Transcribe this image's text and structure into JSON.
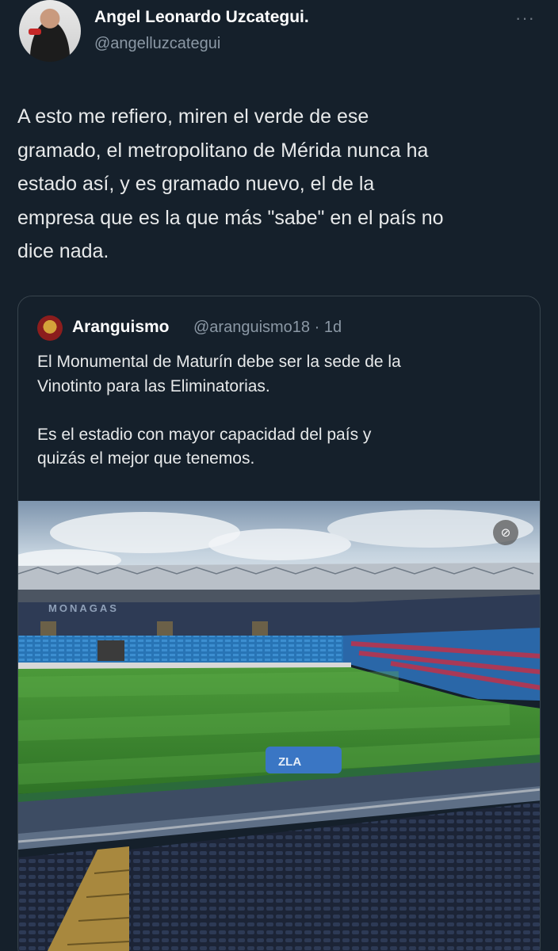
{
  "author": {
    "display_name": "Angel Leonardo Uzcategui.",
    "handle": "@angelluzcategui",
    "avatar_icon": "profile-photo-avatar"
  },
  "more_menu": {
    "icon": "ellipsis-icon",
    "glyph": "···"
  },
  "tweet": {
    "lines": [
      "A esto me refiero, miren el verde de ese",
      "gramado, el metropolitano de Mérida nunca ha",
      "estado así, y es gramado nuevo, el de la",
      "empresa que es la que más \"sabe\" en el país no",
      "dice nada."
    ]
  },
  "quoted_tweet": {
    "display_name": "Aranguismo",
    "handle_time": "@aranguismo18 · 1d",
    "paragraphs": [
      [
        "El Monumental de Maturín debe ser la sede de la",
        "Vinotinto para las Eliminatorias."
      ],
      [
        "Es el estadio con mayor capacidad del país y",
        "quizás el mejor que tenemos."
      ]
    ],
    "media": {
      "description_icon": "stadium-photo",
      "stadium_sign": "MONAGAS",
      "tunnel_sign": "ZLA",
      "colors": {
        "sky": "#9db3c9",
        "pitch": "#3f8f32",
        "seats_dark": "#1f2a44",
        "seats_blue": "#2f7fc1",
        "seats_red": "#c0324a"
      }
    },
    "sensitive_icon_glyph": "⊘"
  },
  "colors": {
    "background": "#15202b",
    "text_primary": "#e7e9ea",
    "text_secondary": "#8b98a5",
    "border": "#38444d"
  }
}
